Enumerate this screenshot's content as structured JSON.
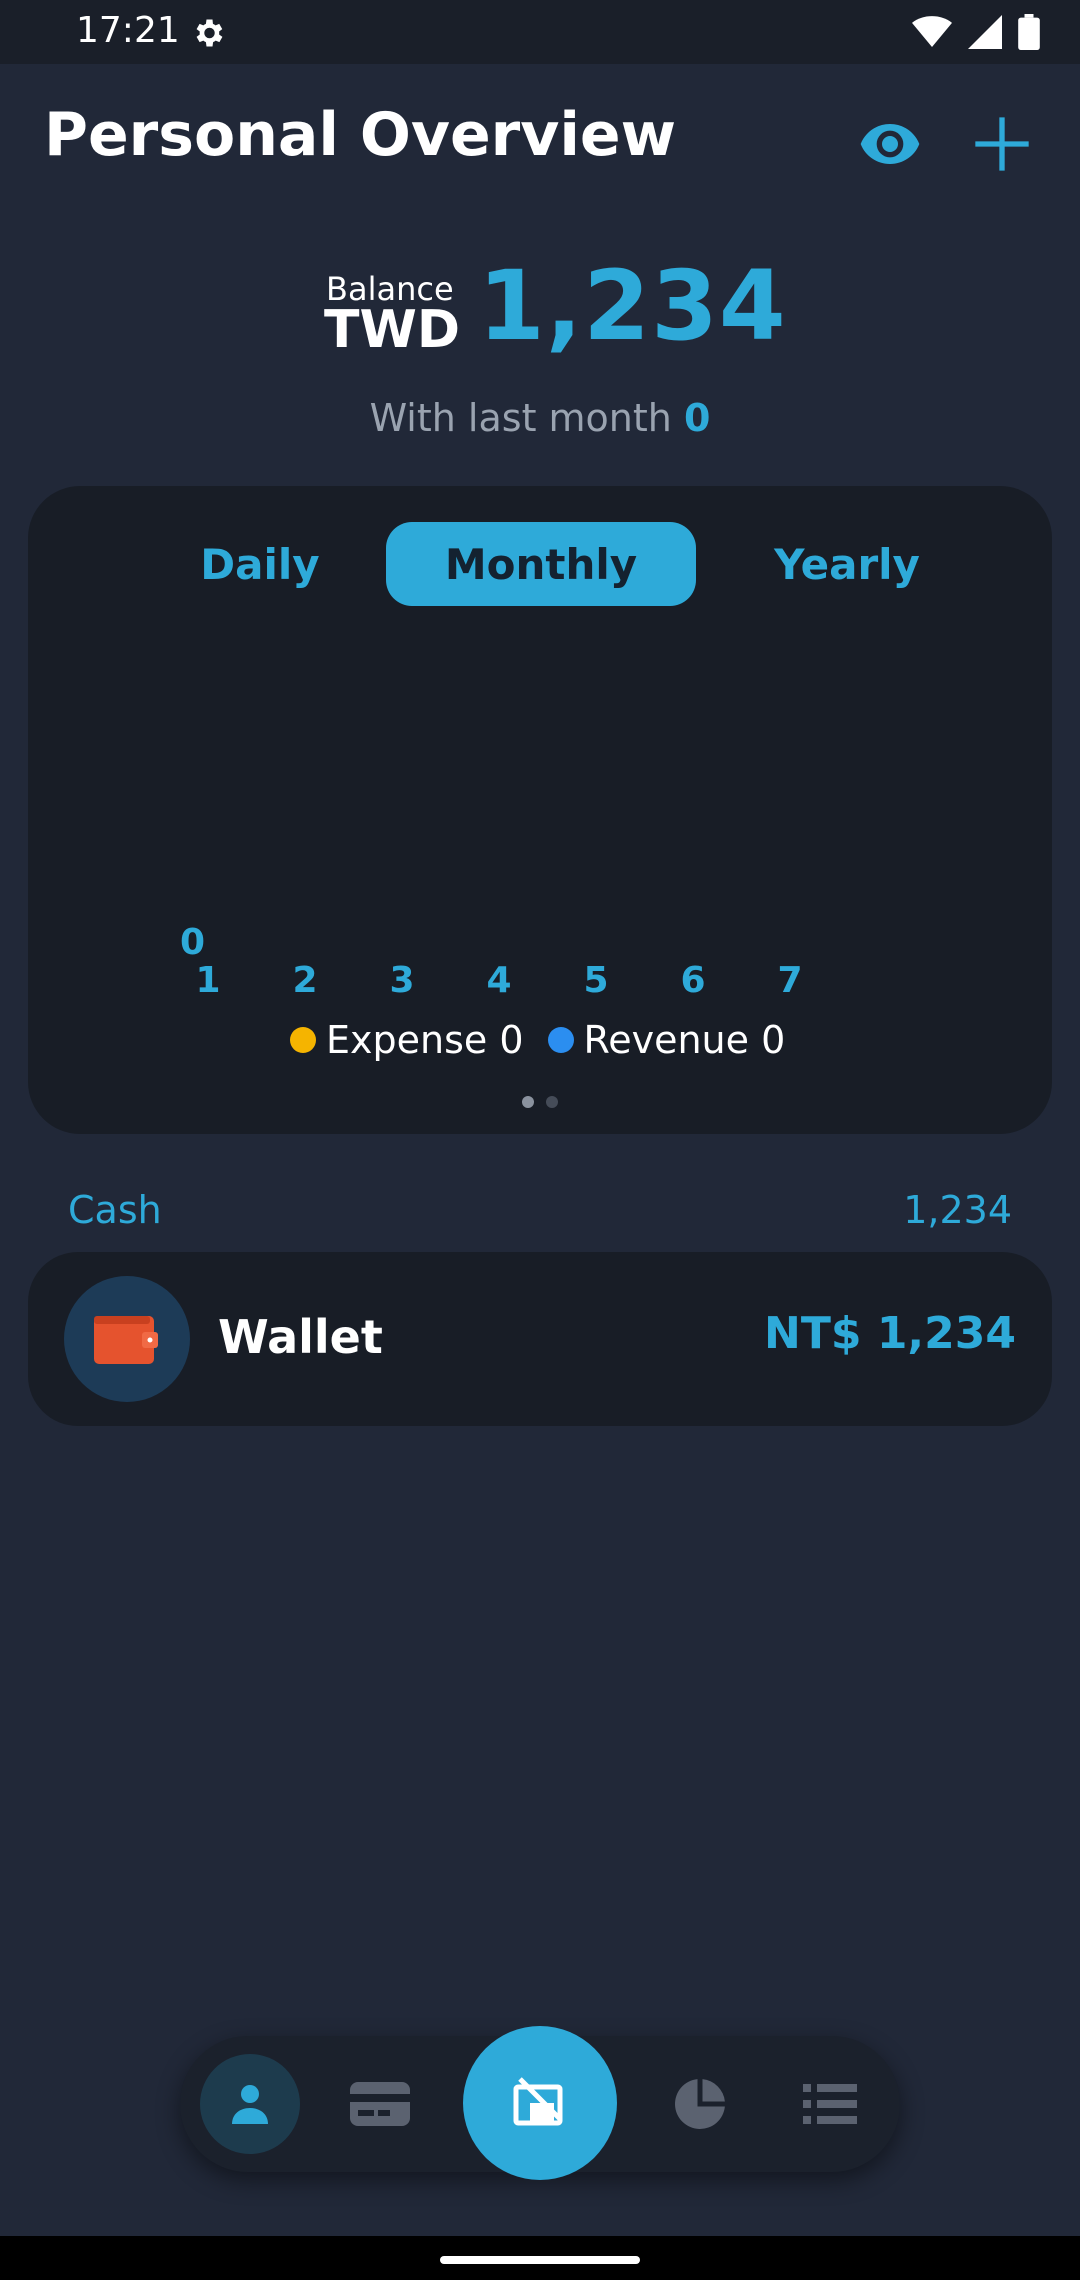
{
  "status_bar": {
    "time": "17:21"
  },
  "header": {
    "title": "Personal Overview"
  },
  "balance": {
    "label": "Balance",
    "currency": "TWD",
    "amount": "1,234",
    "last_month_label": "With last month",
    "last_month_value": "0"
  },
  "chart_card": {
    "tabs": [
      "Daily",
      "Monthly",
      "Yearly"
    ],
    "selected_tab": "Monthly",
    "pager": {
      "pages": 2,
      "current": 1
    }
  },
  "chart_data": {
    "type": "bar",
    "categories": [
      "1",
      "2",
      "3",
      "4",
      "5",
      "6",
      "7"
    ],
    "series": [
      {
        "name": "Expense 0",
        "values": [
          0,
          0,
          0,
          0,
          0,
          0,
          0
        ],
        "color": "#f5b400"
      },
      {
        "name": "Revenue 0",
        "values": [
          0,
          0,
          0,
          0,
          0,
          0,
          0
        ],
        "color": "#2b8ef0"
      }
    ],
    "y_tick_labels": [
      "0"
    ]
  },
  "accounts": {
    "section_title": "Cash",
    "section_total": "1,234",
    "items": [
      {
        "name": "Wallet",
        "amount": "NT$ 1,234",
        "icon": "wallet-icon"
      }
    ]
  },
  "bottom_nav": {
    "items": [
      {
        "icon": "person-icon",
        "active": true
      },
      {
        "icon": "card-icon",
        "active": false
      },
      {
        "icon": "pie-chart-icon",
        "active": false
      },
      {
        "icon": "list-icon",
        "active": false
      }
    ],
    "fab_icon": "add-record-icon"
  },
  "colors": {
    "background": "#212838",
    "card": "#181d26",
    "accent": "#2eaad9",
    "expense": "#f5b400",
    "revenue": "#2b8ef0"
  }
}
